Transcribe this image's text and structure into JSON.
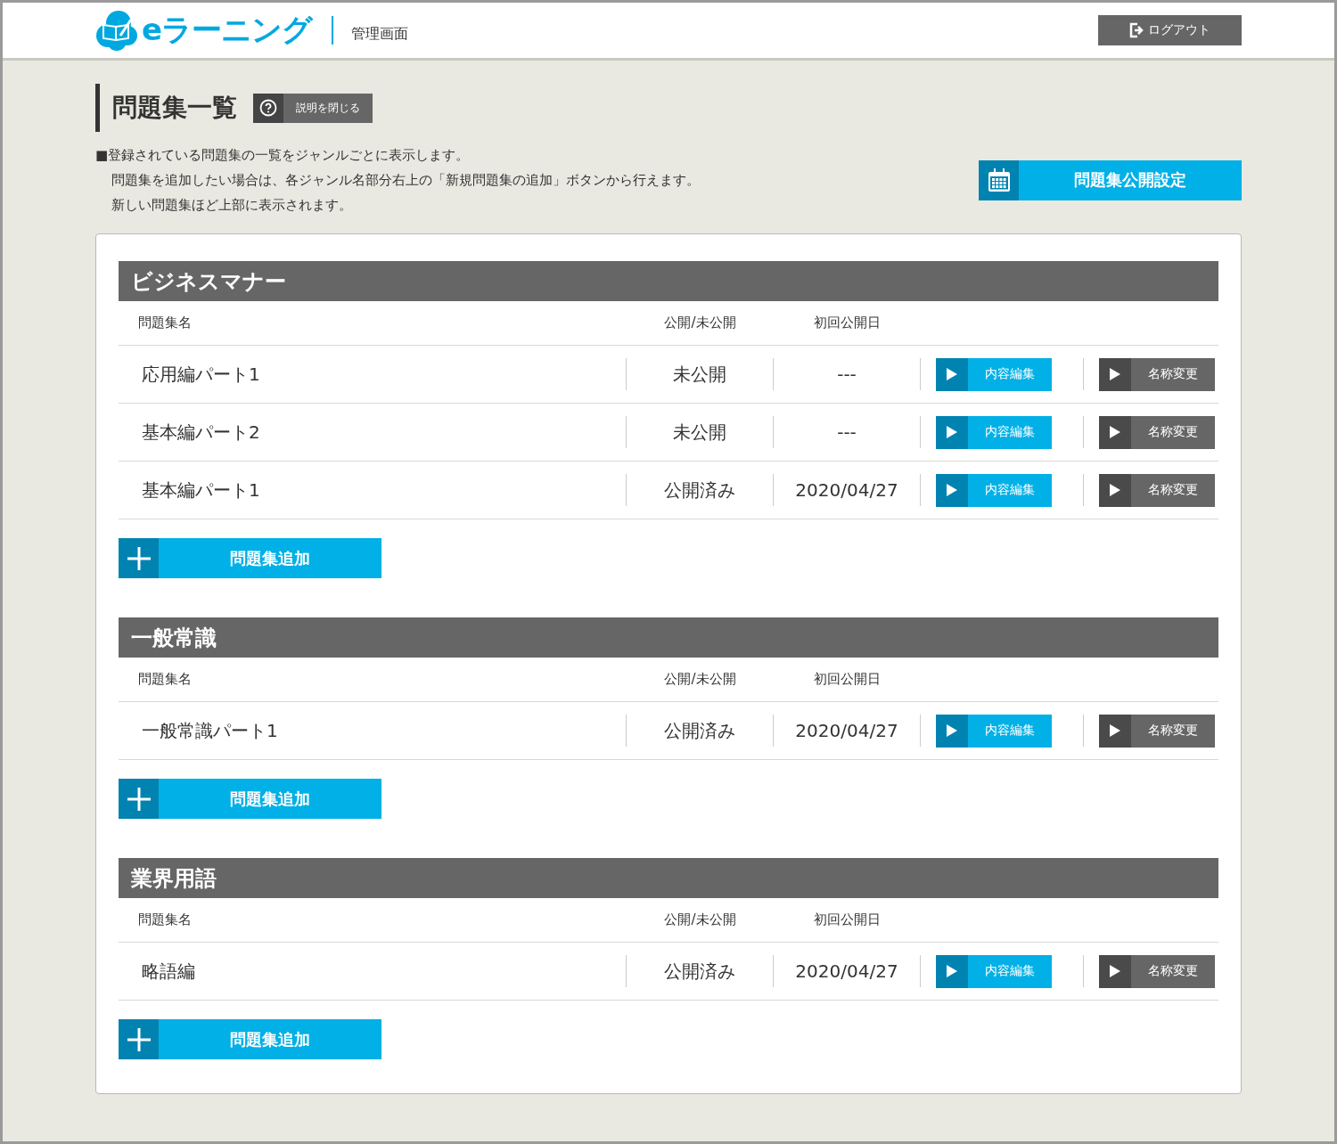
{
  "header": {
    "logo_text": "eラーニング",
    "subtitle": "管理画面",
    "logout_button": "ログアウト"
  },
  "page": {
    "title": "問題集一覧",
    "help_button": "説明を閉じる",
    "description": [
      "■登録されている問題集の一覧をジャンルごとに表示します。",
      "問題集を追加したい場合は、各ジャンル名部分右上の「新規問題集の追加」ボタンから行えます。",
      "新しい問題集ほど上部に表示されます。"
    ],
    "publish_settings_button": "問題集公開設定"
  },
  "genres": [
    {
      "name": "ビジネスマナー",
      "columns": [
        "問題集名",
        "公開/未公開",
        "初回公開日"
      ],
      "rows": [
        {
          "name": "応用編パート1",
          "status": "未公開",
          "date": "---",
          "edit_button": "内容編集",
          "rename_button": "名称変更"
        },
        {
          "name": "基本編パート2",
          "status": "未公開",
          "date": "---",
          "edit_button": "内容編集",
          "rename_button": "名称変更"
        },
        {
          "name": "基本編パート1",
          "status": "公開済み",
          "date": "2020/04/27",
          "edit_button": "内容編集",
          "rename_button": "名称変更"
        }
      ],
      "add_button": "問題集追加"
    },
    {
      "name": "一般常識",
      "columns": [
        "問題集名",
        "公開/未公開",
        "初回公開日"
      ],
      "rows": [
        {
          "name": "一般常識パート1",
          "status": "公開済み",
          "date": "2020/04/27",
          "edit_button": "内容編集",
          "rename_button": "名称変更"
        }
      ],
      "add_button": "問題集追加"
    },
    {
      "name": "業界用語",
      "columns": [
        "問題集名",
        "公開/未公開",
        "初回公開日"
      ],
      "rows": [
        {
          "name": "略語編",
          "status": "公開済み",
          "date": "2020/04/27",
          "edit_button": "内容編集",
          "rename_button": "名称変更"
        }
      ],
      "add_button": "問題集追加"
    }
  ]
}
